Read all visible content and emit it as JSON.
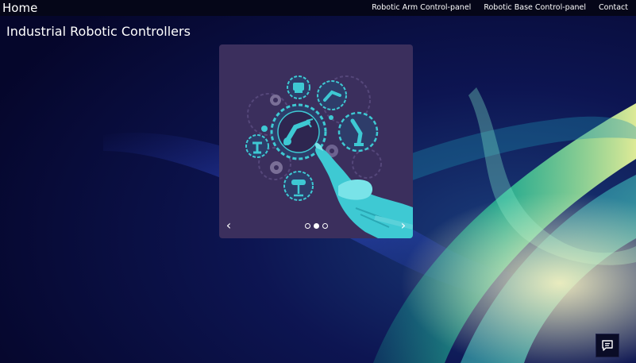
{
  "navbar": {
    "brand": "Home",
    "links": [
      {
        "label": "Robotic Arm Control-panel"
      },
      {
        "label": "Robotic Base Control-panel"
      },
      {
        "label": "Contact"
      }
    ]
  },
  "page": {
    "title": "Industrial Robotic Controllers"
  },
  "carousel": {
    "prev_label": "‹",
    "next_label": "›",
    "slide_count": 3,
    "active_index": 1,
    "image_icon": "robot-hand-gears-illustration"
  },
  "chat": {
    "icon": "chat-icon"
  },
  "colors": {
    "navbar_bg": "#050618",
    "background_base": "#07083a",
    "carousel_bg": "#3b2f5d",
    "accent_cyan": "#3ec9d3",
    "text": "#ffffff"
  }
}
